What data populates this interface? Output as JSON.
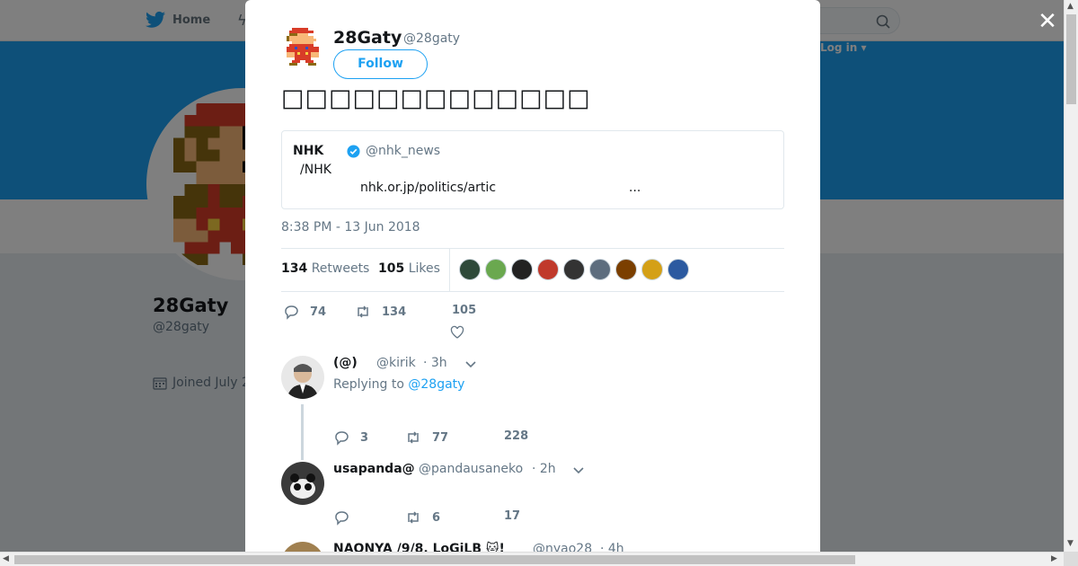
{
  "nav": {
    "home_label": "Home",
    "login_label": "Log in ▾"
  },
  "profile": {
    "name": "28Gaty",
    "handle": "@28gaty",
    "joined": "Joined July 2"
  },
  "tweet": {
    "author_name": "28Gaty",
    "author_handle": "@28gaty",
    "follow_label": "Follow",
    "text": "□□□□□□□□□□□□□",
    "timestamp": "8:38 PM - 13 Jun 2018",
    "quote": {
      "name": "NHK",
      "handle": "@nhk_news",
      "line2": "/NHK",
      "link": "nhk.or.jp/politics/artic",
      "ellipsis": "..."
    },
    "stats": {
      "retweets_count": "134",
      "retweets_label": "Retweets",
      "likes_count": "105",
      "likes_label": "Likes"
    },
    "actions": {
      "replies": "74",
      "retweets": "134",
      "likes": "105"
    }
  },
  "replies": [
    {
      "name": "(@)",
      "handle": "@kirik",
      "time": "· 3h",
      "replying_prefix": "Replying to",
      "replying_to": "@28gaty",
      "replies": "3",
      "retweets": "77",
      "likes": "228"
    },
    {
      "name": "usapanda@",
      "handle": "@pandausaneko",
      "time": "· 2h",
      "replies": "",
      "retweets": "6",
      "likes": "17"
    },
    {
      "name": "NAONYA /9/8. LoGiLB 🐱!",
      "handle": "@nyao28",
      "time": "· 4h"
    }
  ],
  "colors": {
    "accent": "#1da1f2",
    "banner": "#1da1f2",
    "text": "#14171a",
    "muted": "#657786"
  },
  "likers": [
    "#2e4a3a",
    "#6aa84f",
    "#222222",
    "#c0392b",
    "#333333",
    "#5d6d7e",
    "#7b3f00",
    "#d4a017",
    "#2c5aa0"
  ]
}
